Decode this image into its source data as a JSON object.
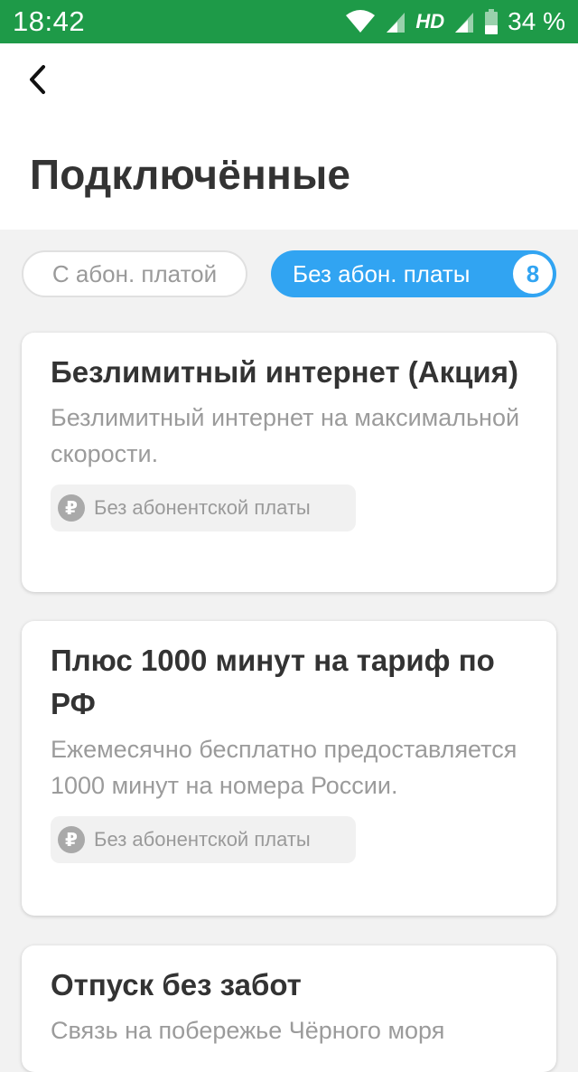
{
  "status_bar": {
    "time": "18:42",
    "network": "HD",
    "battery": "34 %",
    "icons": [
      "wifi-icon",
      "signal-icon",
      "battery-icon"
    ]
  },
  "header": {
    "back_icon": "chevron-left-icon",
    "title": "Подключённые"
  },
  "filters": {
    "with_fee": "С абон. платой",
    "without_fee": "Без абон. платы",
    "without_fee_count": "8"
  },
  "cards": [
    {
      "title": "Безлимитный интернет (Акция)",
      "description": "Безлимитный интернет на максимальной скорости.",
      "badge": "Без абонентской платы"
    },
    {
      "title": "Плюс 1000 минут на тариф по РФ",
      "description": "Ежемесячно бесплатно предоставляется 1000 минут на номера России.",
      "badge": "Без абонентской платы"
    },
    {
      "title": "Отпуск без забот",
      "description": "Связь на побережье Чёрного моря"
    }
  ],
  "colors": {
    "status_bar": "#1e9a48",
    "accent": "#31a4f2"
  }
}
